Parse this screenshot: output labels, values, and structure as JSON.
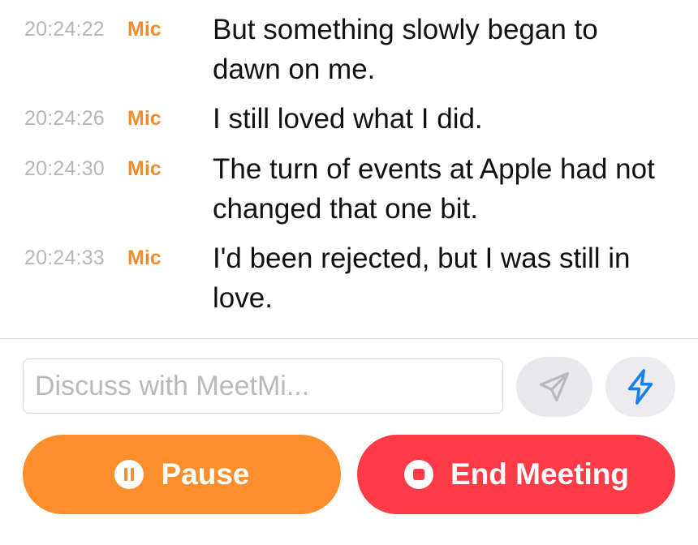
{
  "transcript": [
    {
      "time": "20:24:22",
      "speaker": "Mic",
      "text": "But something slowly began to dawn on me."
    },
    {
      "time": "20:24:26",
      "speaker": "Mic",
      "text": "I still loved what I did."
    },
    {
      "time": "20:24:30",
      "speaker": "Mic",
      "text": "The turn of events at Apple had not changed that one bit."
    },
    {
      "time": "20:24:33",
      "speaker": "Mic",
      "text": "I'd been rejected, but I was still in love."
    }
  ],
  "composer": {
    "placeholder": "Discuss with MeetMi...",
    "value": ""
  },
  "icons": {
    "send": "paper-plane-icon",
    "quick_action": "lightning-bolt-icon",
    "pause": "pause-icon",
    "stop": "stop-icon"
  },
  "actions": {
    "pause_label": "Pause",
    "end_label": "End Meeting"
  },
  "colors": {
    "speaker": "#f08c2c",
    "pause_button": "#fd8e2c",
    "end_button": "#ff3b47",
    "bolt": "#1a7ff0"
  }
}
